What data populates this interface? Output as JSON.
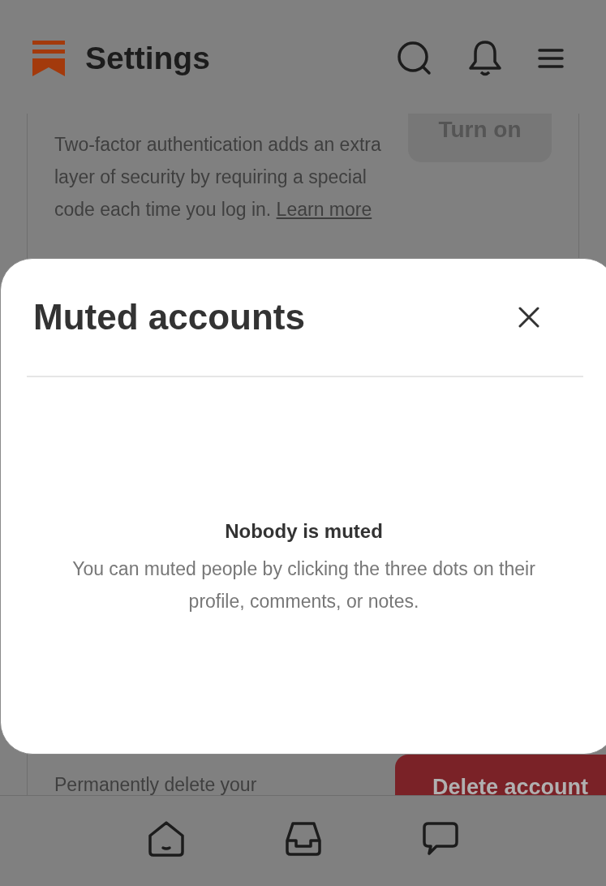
{
  "header": {
    "title": "Settings"
  },
  "settings": [
    {
      "kind": "toggle",
      "description": "Two-factor authentication adds an extra layer of security by requiring a special code each time you log in.",
      "link": "Learn more",
      "button": "Turn on"
    },
    {
      "kind": "danger",
      "description": "Permanently delete your",
      "button": "Delete account"
    }
  ],
  "modal": {
    "title": "Muted accounts",
    "empty_title": "Nobody is muted",
    "empty_description": "You can muted people by clicking the three dots on their profile, comments, or notes."
  }
}
